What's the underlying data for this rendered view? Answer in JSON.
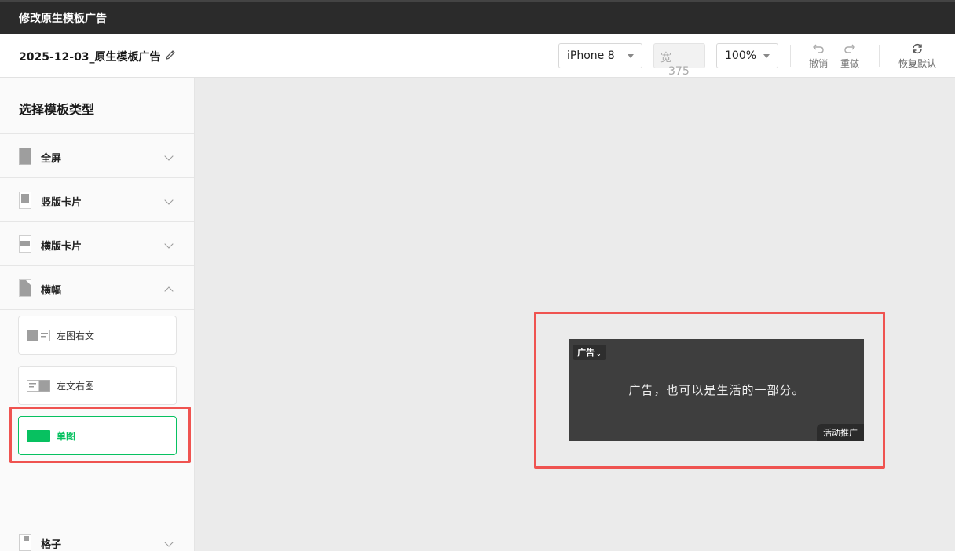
{
  "window": {
    "title": "修改原生模板广告"
  },
  "toolbar": {
    "doc_title": "2025-12-03_原生模板广告",
    "device": "iPhone 8",
    "width_label": "宽",
    "width_value": "375",
    "zoom": "100%",
    "undo": "撤销",
    "redo": "重做",
    "reset": "恢复默认"
  },
  "sidebar": {
    "heading": "选择模板类型",
    "categories": [
      {
        "label": "全屏"
      },
      {
        "label": "竖版卡片"
      },
      {
        "label": "横版卡片"
      },
      {
        "label": "横幅"
      },
      {
        "label": "格子"
      }
    ],
    "banner_options": [
      {
        "label": "左图右文"
      },
      {
        "label": "左文右图"
      },
      {
        "label": "单图"
      }
    ]
  },
  "preview": {
    "ad_tag": "广告",
    "ad_text": "广告，也可以是生活的一部分。",
    "cta": "活动推广"
  },
  "colors": {
    "accent": "#07c160",
    "highlight": "#ef5350"
  }
}
